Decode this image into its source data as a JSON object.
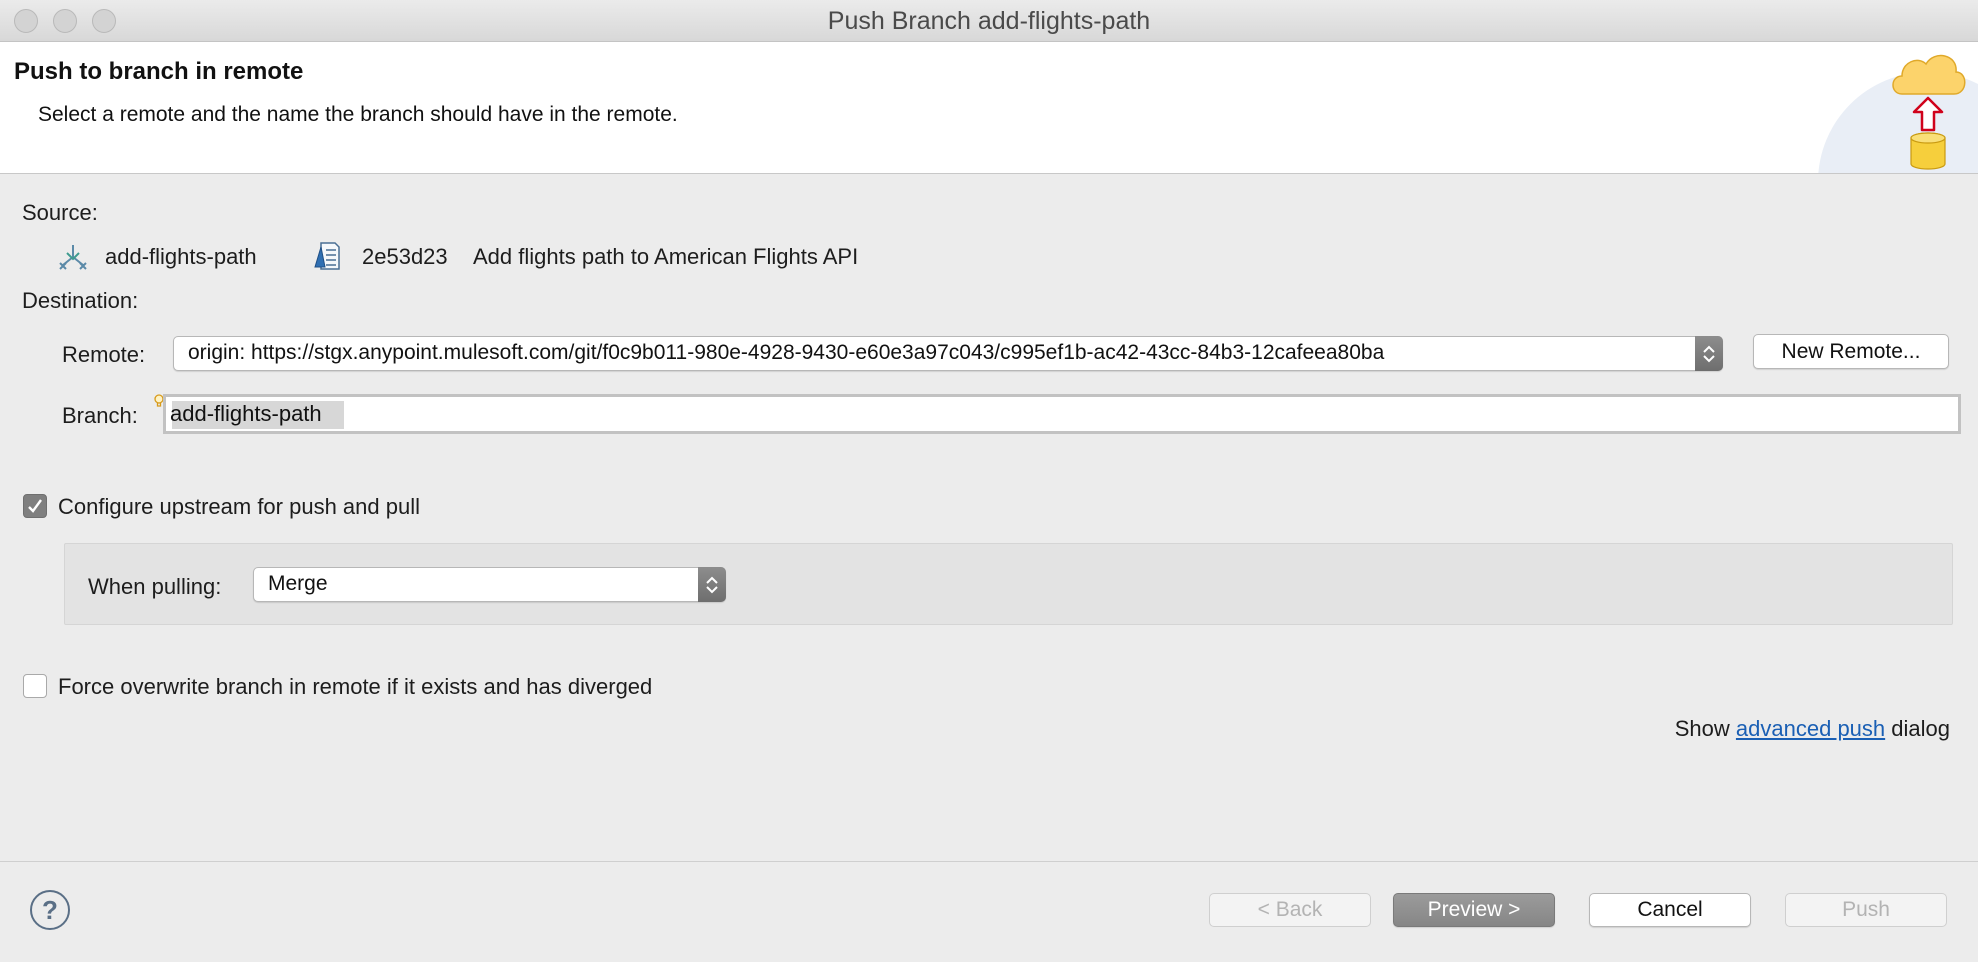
{
  "window": {
    "title": "Push Branch add-flights-path"
  },
  "banner": {
    "title": "Push to branch in remote",
    "description": "Select a remote and the name the branch should have in the remote."
  },
  "source": {
    "label": "Source:",
    "branch": "add-flights-path",
    "commit_id": "2e53d23",
    "commit_message": "Add flights path to American Flights API"
  },
  "destination": {
    "label": "Destination:",
    "remote_label": "Remote:",
    "remote_value": "origin: https://stgx.anypoint.mulesoft.com/git/f0c9b011-980e-4928-9430-e60e3a97c043/c995ef1b-ac42-43cc-84b3-12cafeea80ba",
    "new_remote_button": "New Remote...",
    "branch_label": "Branch:",
    "branch_value": "add-flights-path"
  },
  "upstream": {
    "checkbox_label": "Configure upstream for push and pull",
    "checked": true,
    "when_pulling_label": "When pulling:",
    "when_pulling_value": "Merge"
  },
  "force": {
    "checkbox_label": "Force overwrite branch in remote if it exists and has diverged",
    "checked": false
  },
  "advanced": {
    "prefix": "Show",
    "link": "advanced push",
    "suffix": "dialog"
  },
  "footer": {
    "help": "?",
    "back": "< Back",
    "preview": "Preview >",
    "cancel": "Cancel",
    "push": "Push"
  },
  "icons": {
    "banner": "cloud-push-icon",
    "branch": "branch-icon",
    "commit": "commit-icon",
    "help": "help-icon"
  }
}
